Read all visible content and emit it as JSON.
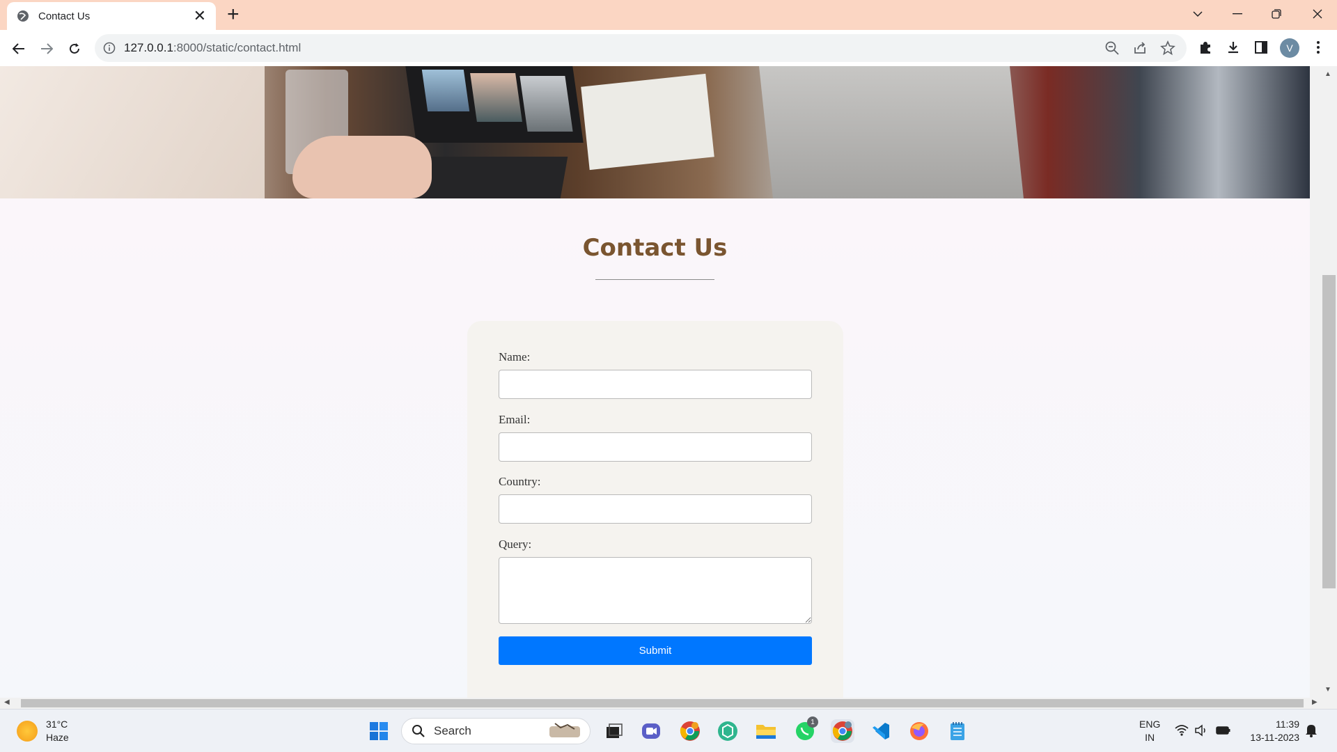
{
  "browser": {
    "tab_title": "Contact Us",
    "url_host": "127.0.0.1",
    "url_path": ":8000/static/contact.html",
    "profile_initial": "V"
  },
  "page": {
    "title": "Contact Us",
    "form": {
      "name_label": "Name:",
      "email_label": "Email:",
      "country_label": "Country:",
      "query_label": "Query:",
      "name_value": "",
      "email_value": "",
      "country_value": "",
      "query_value": "",
      "submit_label": "Submit"
    },
    "colors": {
      "title": "#7a5530",
      "submit": "#0077ff"
    }
  },
  "taskbar": {
    "weather_temp": "31°C",
    "weather_desc": "Haze",
    "search_label": "Search",
    "lang_top": "ENG",
    "lang_bottom": "IN",
    "time": "11:39",
    "date": "13-11-2023",
    "whatsapp_badge": "1",
    "apps": [
      "start-icon",
      "search-icon",
      "task-view-icon",
      "teams-icon",
      "chrome-icon",
      "chatgpt-icon",
      "file-explorer-icon",
      "whatsapp-icon",
      "chrome-active-icon",
      "vscode-icon",
      "firefox-icon",
      "notepad-icon"
    ]
  }
}
